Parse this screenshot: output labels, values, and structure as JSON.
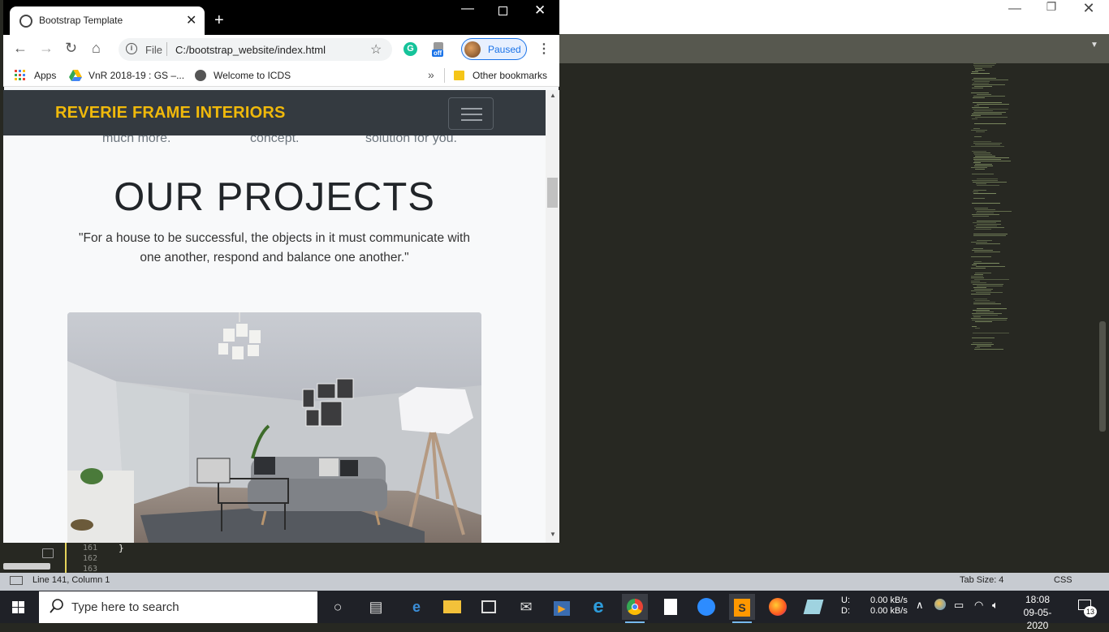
{
  "sublime": {
    "line_numbers": [
      "161",
      "162",
      "163"
    ],
    "code_line_161": "}",
    "status": {
      "position": "Line 141, Column 1",
      "tab_size": "Tab Size: 4",
      "syntax": "CSS"
    }
  },
  "chrome": {
    "tab_title": "Bootstrap Template",
    "omnibox": {
      "scheme_label": "File",
      "url": "C:/bootstrap_website/index.html"
    },
    "profile_label": "Paused",
    "extension_badge": "off",
    "bookmarks": {
      "apps": "Apps",
      "vnr": "VnR 2018-19 : GS –...",
      "icds": "Welcome to ICDS",
      "other": "Other bookmarks"
    }
  },
  "website": {
    "brand": "REVERIE FRAME INTERIORS",
    "previous_section_fragments": [
      "much more.",
      "concept.",
      "solution for you."
    ],
    "projects_title": "OUR PROJECTS",
    "projects_quote": "\"For a house to be successful, the objects in it must communicate with one another, respond and balance one another.\"",
    "brand_color": "#f0b90b",
    "navbar_color": "#343a40"
  },
  "taskbar": {
    "search_placeholder": "Type here to search",
    "net_up_label": "U:",
    "net_down_label": "D:",
    "net_up": "0.00 kB/s",
    "net_down": "0.00 kB/s",
    "time": "18:08",
    "date": "09-05-2020",
    "notification_count": "13",
    "icons": [
      "cortana-icon",
      "task-view-icon",
      "edge-icon",
      "file-explorer-icon",
      "store-icon",
      "mail-icon",
      "media-player-icon",
      "internet-explorer-icon",
      "chrome-icon",
      "notepad-icon",
      "zoom-icon",
      "sublime-text-icon",
      "firefox-icon",
      "snipping-tool-icon"
    ]
  }
}
